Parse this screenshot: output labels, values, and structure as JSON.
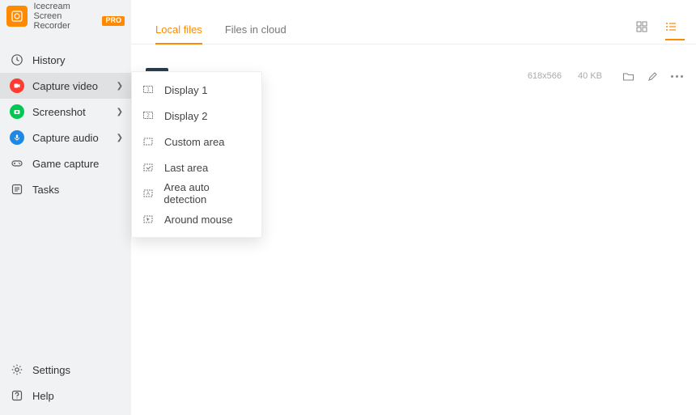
{
  "brand": {
    "line1": "Icecream",
    "line2": "Screen Recorder",
    "badge": "PRO"
  },
  "sidebar": {
    "items": [
      {
        "label": "History"
      },
      {
        "label": "Capture video"
      },
      {
        "label": "Screenshot"
      },
      {
        "label": "Capture audio"
      },
      {
        "label": "Game capture"
      },
      {
        "label": "Tasks"
      }
    ],
    "settings": "Settings",
    "help": "Help"
  },
  "tabs": {
    "local": "Local files",
    "cloud": "Files in cloud"
  },
  "file": {
    "dimensions": "618x566",
    "size": "40 KB"
  },
  "dropdown": {
    "items": [
      "Display 1",
      "Display 2",
      "Custom area",
      "Last area",
      "Area auto detection",
      "Around mouse"
    ]
  }
}
